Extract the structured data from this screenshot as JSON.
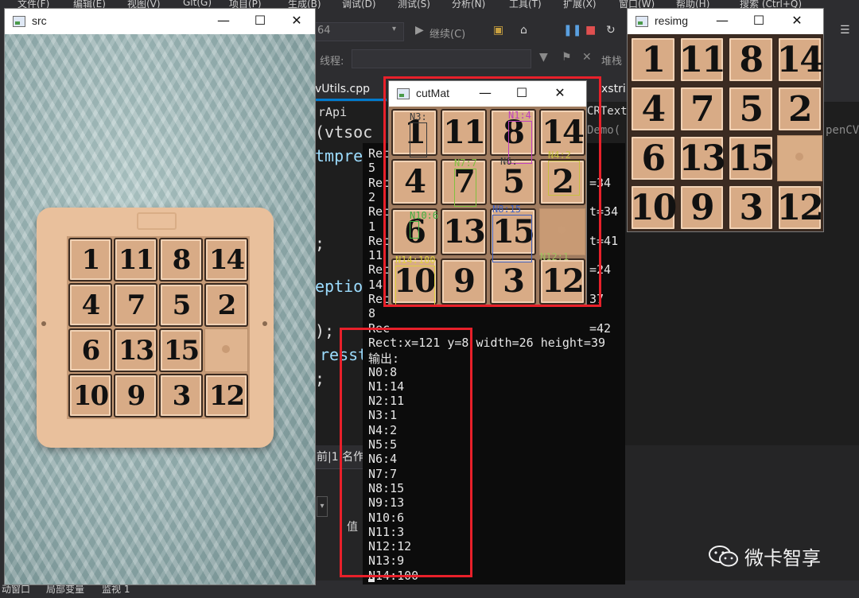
{
  "ide": {
    "menu": [
      "文件(F)",
      "编辑(E)",
      "视图(V)",
      "Git(G)",
      "项目(P)",
      "生成(B)",
      "调试(D)",
      "测试(S)",
      "分析(N)",
      "工具(T)",
      "扩展(X)",
      "窗口(W)",
      "帮助(H)",
      "搜索 (Ctrl+Q)"
    ],
    "toolbar": {
      "config_suffix": "64",
      "continue_label": "继续(C)",
      "thread_label": "线程:",
      "stack_label": "堆栈"
    },
    "tabs": [
      "vUtils.cpp",
      "xstrin",
      "rApi",
      "CRTextF"
    ],
    "tab_fragment": "Demo(",
    "tab_fragment2": "penCV",
    "code_lines": [
      "(vtsoc",
      "tmprec",
      ";",
      "eption",
      ");",
      "resst",
      ";"
    ],
    "bottom_panel": {
      "header": "前|1 名作",
      "value_label": "值"
    },
    "statusbar": [
      "动窗口",
      "局部变量",
      "监视 1"
    ]
  },
  "console": {
    "lines": [
      {
        "text": "5"
      },
      {
        "text": "Rec",
        "tail": "=34"
      },
      {
        "text": "2"
      },
      {
        "text": "Rec",
        "tail": "t=34"
      },
      {
        "text": "1"
      },
      {
        "text": "Rec",
        "tail": "t=41"
      },
      {
        "text": "11"
      },
      {
        "text": "Rec",
        "tail": "=24"
      },
      {
        "text": "14"
      },
      {
        "text": "Rec",
        "tail": "37"
      },
      {
        "text": "8"
      },
      {
        "text": "Rec",
        "tail": "=42"
      },
      {
        "text": "Rect:x=121 y=8 width=26 height=39"
      },
      {
        "text": "输出:"
      },
      {
        "text": "N0:8"
      },
      {
        "text": "N1:14"
      },
      {
        "text": "N2:11"
      },
      {
        "text": "N3:1"
      },
      {
        "text": "N4:2"
      },
      {
        "text": "N5:5"
      },
      {
        "text": "N6:4"
      },
      {
        "text": "N7:7"
      },
      {
        "text": "N8:15"
      },
      {
        "text": "N9:13"
      },
      {
        "text": "N10:6"
      },
      {
        "text": "N11:3"
      },
      {
        "text": "N12:12"
      },
      {
        "text": "N13:9"
      },
      {
        "text": "N14:100"
      }
    ],
    "first_line": "Rec"
  },
  "windows": {
    "src": {
      "title": "src"
    },
    "cutMat": {
      "title": "cutMat"
    },
    "resimg": {
      "title": "resimg"
    }
  },
  "puzzle": {
    "rows": [
      [
        "1",
        "11",
        "8",
        "14"
      ],
      [
        "4",
        "7",
        "5",
        "2"
      ],
      [
        "6",
        "13",
        "15",
        ""
      ],
      [
        "10",
        "9",
        "3",
        "12"
      ]
    ]
  },
  "cut_annotations": [
    {
      "text": "N3:",
      "color": "#3a3a3a"
    },
    {
      "text": "N1:4",
      "color": "#c040c0"
    },
    {
      "text": "N4:2",
      "color": "#c8c040"
    },
    {
      "text": "N7:7",
      "color": "#80c040"
    },
    {
      "text": "N6:",
      "color": "#3a3a3a"
    },
    {
      "text": "N8:15",
      "color": "#4060c0"
    },
    {
      "text": "N10:6",
      "color": "#40b040"
    },
    {
      "text": "N14:100",
      "color": "#e0d040"
    },
    {
      "text": "N12:1",
      "color": "#a0c060"
    }
  ],
  "watermark": {
    "text": "微卡智享"
  },
  "colors": {
    "highlight": "#e8202a",
    "accent": "#007acc"
  }
}
